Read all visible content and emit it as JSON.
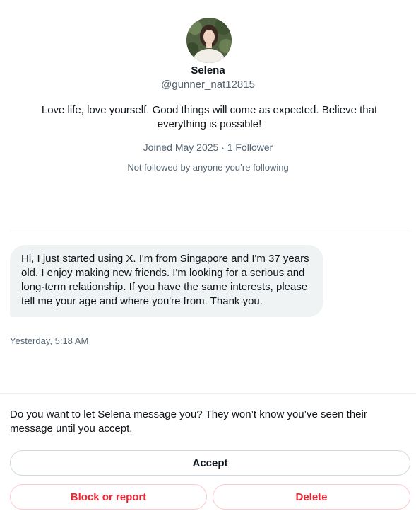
{
  "profile": {
    "name": "Selena",
    "handle": "@gunner_nat12815",
    "bio": "Love life, love yourself. Good things will come as expected. Believe that everything is possible!",
    "meta": "Joined May 2025 · 1 Follower",
    "followed_by": "Not followed by anyone you’re following"
  },
  "message": {
    "text": "Hi, I just started using X. I'm from Singapore and I'm 37 years old. I enjoy making new friends. I'm looking for a serious and long-term relationship. If you have the same interests, please tell me your age and where you're from. Thank you.",
    "timestamp": "Yesterday, 5:18 AM"
  },
  "request": {
    "prompt": "Do you want to let Selena message you? They won’t know you’ve seen their message until you accept.",
    "accept_label": "Accept",
    "block_label": "Block or report",
    "delete_label": "Delete"
  },
  "colors": {
    "text_primary": "#0f1419",
    "text_secondary": "#536471",
    "bubble_bg": "#eff3f4",
    "danger": "#f4212e",
    "danger_border": "#fdc9ce",
    "neutral_border": "#cfd9de"
  }
}
